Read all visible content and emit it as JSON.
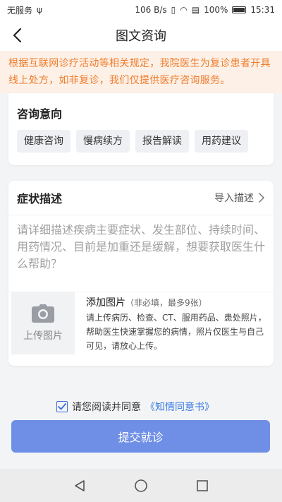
{
  "status_bar": {
    "carrier": "无服务",
    "network_speed": "106 B/s",
    "battery": "100%",
    "time": "15:31"
  },
  "nav": {
    "title": "图文资询"
  },
  "notice": {
    "text": "根据互联网诊疗活动等相关规定，我院医生为复诊患者开具线上处方，如非复诊，我们仅提供医疗咨询服务。"
  },
  "intent": {
    "title": "咨询意向",
    "options": [
      "健康咨询",
      "慢病续方",
      "报告解读",
      "用药建议"
    ]
  },
  "symptom": {
    "title": "症状描述",
    "import_label": "导入描述",
    "placeholder": "请详细描述疾病主要症状、发生部位、持续时间、用药情况、目前是加重还是缓解，想要获取医生什么帮助？",
    "upload_label": "上传图片",
    "add_image_title": "添加图片",
    "add_image_note": "（非必填，最多9张）",
    "add_image_desc": "请上传病历、检查、CT、服用药品、患处照片，帮助医生快速掌握您的病情，照片仅医生与自己可见，请放心上传。"
  },
  "agreement": {
    "prefix": "请您阅读并同意",
    "link": "《知情同意书》",
    "checked": true
  },
  "submit": {
    "label": "提交就诊"
  },
  "colors": {
    "accent": "#6f8fe6",
    "notice_text": "#f07c2c",
    "notice_bg": "#fdf0e6",
    "link": "#3a7be0"
  }
}
